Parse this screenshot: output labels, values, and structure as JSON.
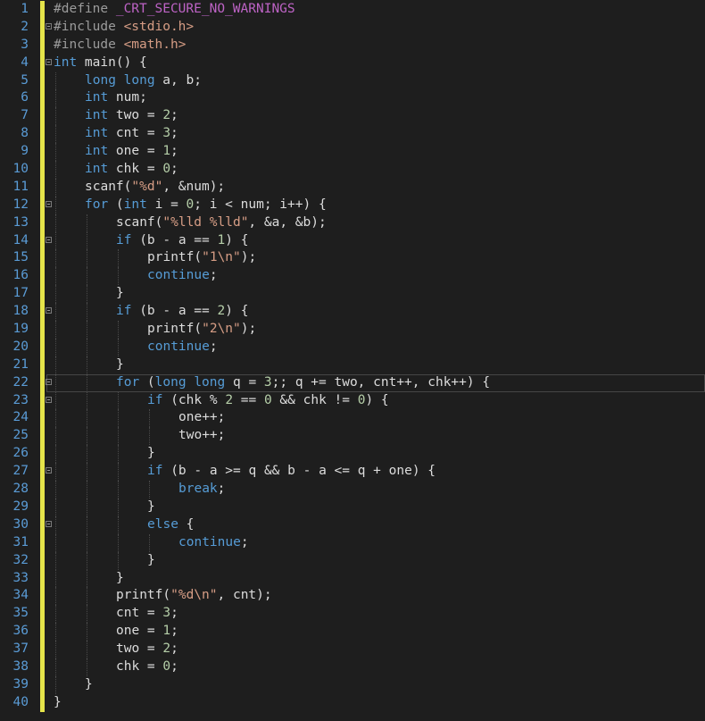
{
  "editor": {
    "current_line": 22,
    "line_numbers": [
      "1",
      "2",
      "3",
      "4",
      "5",
      "6",
      "7",
      "8",
      "9",
      "10",
      "11",
      "12",
      "13",
      "14",
      "15",
      "16",
      "17",
      "18",
      "19",
      "20",
      "21",
      "22",
      "23",
      "24",
      "25",
      "26",
      "27",
      "28",
      "29",
      "30",
      "31",
      "32",
      "33",
      "34",
      "35",
      "36",
      "37",
      "38",
      "39",
      "40"
    ],
    "lines": [
      {
        "indent": 0,
        "fold": false,
        "tokens": [
          [
            "pp",
            "#define "
          ],
          [
            "macro",
            "_CRT_SECURE_NO_WARNINGS"
          ]
        ]
      },
      {
        "indent": 0,
        "fold": true,
        "tokens": [
          [
            "pp",
            "#include "
          ],
          [
            "inc",
            "<stdio.h>"
          ]
        ]
      },
      {
        "indent": 0,
        "fold": false,
        "tokens": [
          [
            "pp",
            "#include "
          ],
          [
            "inc",
            "<math.h>"
          ]
        ]
      },
      {
        "indent": 0,
        "fold": true,
        "tokens": [
          [
            "kw",
            "int"
          ],
          [
            "txt",
            " main() {"
          ]
        ]
      },
      {
        "indent": 1,
        "fold": false,
        "tokens": [
          [
            "kw",
            "long long"
          ],
          [
            "txt",
            " a, b;"
          ]
        ]
      },
      {
        "indent": 1,
        "fold": false,
        "tokens": [
          [
            "kw",
            "int"
          ],
          [
            "txt",
            " num;"
          ]
        ]
      },
      {
        "indent": 1,
        "fold": false,
        "tokens": [
          [
            "kw",
            "int"
          ],
          [
            "txt",
            " two = "
          ],
          [
            "num",
            "2"
          ],
          [
            "txt",
            ";"
          ]
        ]
      },
      {
        "indent": 1,
        "fold": false,
        "tokens": [
          [
            "kw",
            "int"
          ],
          [
            "txt",
            " cnt = "
          ],
          [
            "num",
            "3"
          ],
          [
            "txt",
            ";"
          ]
        ]
      },
      {
        "indent": 1,
        "fold": false,
        "tokens": [
          [
            "kw",
            "int"
          ],
          [
            "txt",
            " one = "
          ],
          [
            "num",
            "1"
          ],
          [
            "txt",
            ";"
          ]
        ]
      },
      {
        "indent": 1,
        "fold": false,
        "tokens": [
          [
            "kw",
            "int"
          ],
          [
            "txt",
            " chk = "
          ],
          [
            "num",
            "0"
          ],
          [
            "txt",
            ";"
          ]
        ]
      },
      {
        "indent": 1,
        "fold": false,
        "tokens": [
          [
            "txt",
            "scanf("
          ],
          [
            "str",
            "\"%d\""
          ],
          [
            "txt",
            ", &num);"
          ]
        ]
      },
      {
        "indent": 1,
        "fold": true,
        "tokens": [
          [
            "kw",
            "for"
          ],
          [
            "txt",
            " ("
          ],
          [
            "kw",
            "int"
          ],
          [
            "txt",
            " i = "
          ],
          [
            "num",
            "0"
          ],
          [
            "txt",
            "; i < num; i++) {"
          ]
        ]
      },
      {
        "indent": 2,
        "fold": false,
        "tokens": [
          [
            "txt",
            "scanf("
          ],
          [
            "str",
            "\"%lld %lld\""
          ],
          [
            "txt",
            ", &a, &b);"
          ]
        ]
      },
      {
        "indent": 2,
        "fold": true,
        "tokens": [
          [
            "kw",
            "if"
          ],
          [
            "txt",
            " (b - a == "
          ],
          [
            "num",
            "1"
          ],
          [
            "txt",
            ") {"
          ]
        ]
      },
      {
        "indent": 3,
        "fold": false,
        "tokens": [
          [
            "txt",
            "printf("
          ],
          [
            "str",
            "\"1\\n\""
          ],
          [
            "txt",
            ");"
          ]
        ]
      },
      {
        "indent": 3,
        "fold": false,
        "tokens": [
          [
            "kw",
            "continue"
          ],
          [
            "txt",
            ";"
          ]
        ]
      },
      {
        "indent": 2,
        "fold": false,
        "tokens": [
          [
            "txt",
            "}"
          ]
        ]
      },
      {
        "indent": 2,
        "fold": true,
        "tokens": [
          [
            "kw",
            "if"
          ],
          [
            "txt",
            " (b - a == "
          ],
          [
            "num",
            "2"
          ],
          [
            "txt",
            ") {"
          ]
        ]
      },
      {
        "indent": 3,
        "fold": false,
        "tokens": [
          [
            "txt",
            "printf("
          ],
          [
            "str",
            "\"2\\n\""
          ],
          [
            "txt",
            ");"
          ]
        ]
      },
      {
        "indent": 3,
        "fold": false,
        "tokens": [
          [
            "kw",
            "continue"
          ],
          [
            "txt",
            ";"
          ]
        ]
      },
      {
        "indent": 2,
        "fold": false,
        "tokens": [
          [
            "txt",
            "}"
          ]
        ]
      },
      {
        "indent": 2,
        "fold": true,
        "tokens": [
          [
            "kw",
            "for"
          ],
          [
            "txt",
            " ("
          ],
          [
            "kw",
            "long long"
          ],
          [
            "txt",
            " q = "
          ],
          [
            "num",
            "3"
          ],
          [
            "txt",
            ";; q += two, cnt++, chk++) {"
          ]
        ]
      },
      {
        "indent": 3,
        "fold": true,
        "tokens": [
          [
            "kw",
            "if"
          ],
          [
            "txt",
            " (chk % "
          ],
          [
            "num",
            "2"
          ],
          [
            "txt",
            " == "
          ],
          [
            "num",
            "0"
          ],
          [
            "txt",
            " && chk != "
          ],
          [
            "num",
            "0"
          ],
          [
            "txt",
            ") {"
          ]
        ]
      },
      {
        "indent": 4,
        "fold": false,
        "tokens": [
          [
            "txt",
            "one++;"
          ]
        ]
      },
      {
        "indent": 4,
        "fold": false,
        "tokens": [
          [
            "txt",
            "two++;"
          ]
        ]
      },
      {
        "indent": 3,
        "fold": false,
        "tokens": [
          [
            "txt",
            "}"
          ]
        ]
      },
      {
        "indent": 3,
        "fold": true,
        "tokens": [
          [
            "kw",
            "if"
          ],
          [
            "txt",
            " (b - a >= q && b - a <= q + one) {"
          ]
        ]
      },
      {
        "indent": 4,
        "fold": false,
        "tokens": [
          [
            "kw",
            "break"
          ],
          [
            "txt",
            ";"
          ]
        ]
      },
      {
        "indent": 3,
        "fold": false,
        "tokens": [
          [
            "txt",
            "}"
          ]
        ]
      },
      {
        "indent": 3,
        "fold": true,
        "tokens": [
          [
            "kw",
            "else"
          ],
          [
            "txt",
            " {"
          ]
        ]
      },
      {
        "indent": 4,
        "fold": false,
        "tokens": [
          [
            "kw",
            "continue"
          ],
          [
            "txt",
            ";"
          ]
        ]
      },
      {
        "indent": 3,
        "fold": false,
        "tokens": [
          [
            "txt",
            "}"
          ]
        ]
      },
      {
        "indent": 2,
        "fold": false,
        "tokens": [
          [
            "txt",
            "}"
          ]
        ]
      },
      {
        "indent": 2,
        "fold": false,
        "tokens": [
          [
            "txt",
            "printf("
          ],
          [
            "str",
            "\"%d\\n\""
          ],
          [
            "txt",
            ", cnt);"
          ]
        ]
      },
      {
        "indent": 2,
        "fold": false,
        "tokens": [
          [
            "txt",
            "cnt = "
          ],
          [
            "num",
            "3"
          ],
          [
            "txt",
            ";"
          ]
        ]
      },
      {
        "indent": 2,
        "fold": false,
        "tokens": [
          [
            "txt",
            "one = "
          ],
          [
            "num",
            "1"
          ],
          [
            "txt",
            ";"
          ]
        ]
      },
      {
        "indent": 2,
        "fold": false,
        "tokens": [
          [
            "txt",
            "two = "
          ],
          [
            "num",
            "2"
          ],
          [
            "txt",
            ";"
          ]
        ]
      },
      {
        "indent": 2,
        "fold": false,
        "tokens": [
          [
            "txt",
            "chk = "
          ],
          [
            "num",
            "0"
          ],
          [
            "txt",
            ";"
          ]
        ]
      },
      {
        "indent": 1,
        "fold": false,
        "tokens": [
          [
            "txt",
            "}"
          ]
        ]
      },
      {
        "indent": 0,
        "fold": false,
        "tokens": [
          [
            "txt",
            "}"
          ]
        ]
      }
    ]
  },
  "colors": {
    "background": "#1e1e1e",
    "line_number": "#5a9bd5",
    "change_bar": "#e5e44a",
    "keyword": "#569cd6",
    "string": "#d69d85",
    "number": "#b5cea8",
    "preprocessor": "#9b9b9b",
    "macro": "#bd63c5",
    "text": "#dcdcdc"
  }
}
